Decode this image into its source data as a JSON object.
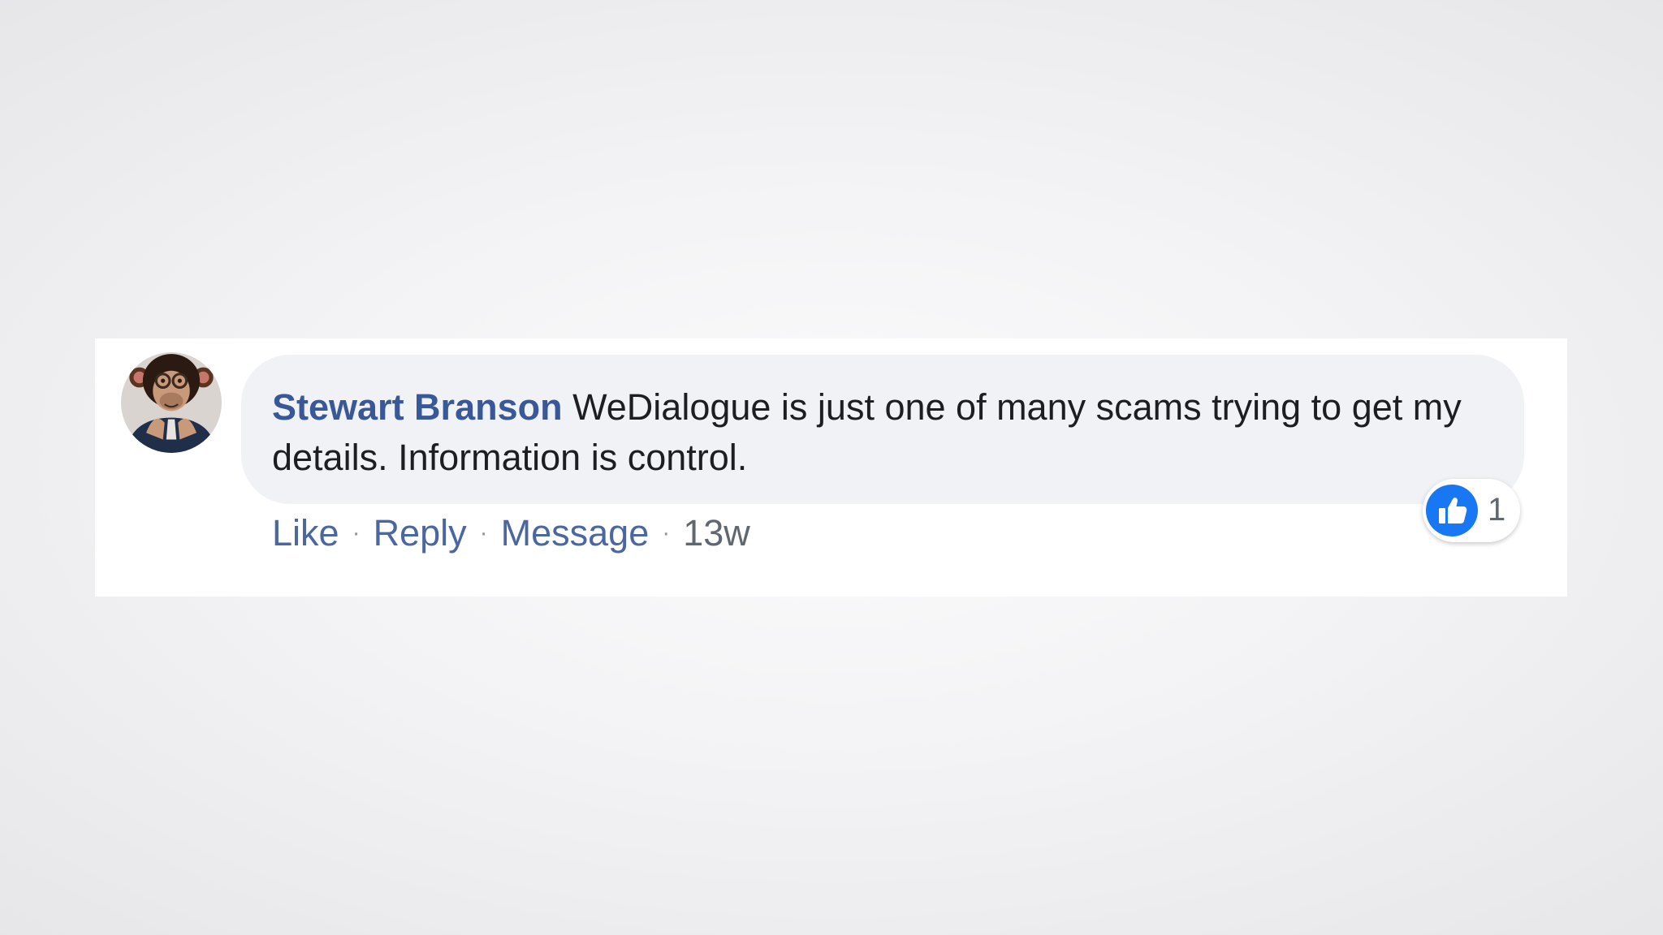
{
  "comment": {
    "author": "Stewart Branson",
    "text": "WeDialogue is just one of many scams trying to get my details. Information is control.",
    "avatar_icon": "chimpanzee-avatar"
  },
  "actions": {
    "like_label": "Like",
    "reply_label": "Reply",
    "message_label": "Message",
    "separator": "·",
    "timestamp": "13w"
  },
  "reactions": {
    "icon": "thumbs-up-icon",
    "count": "1",
    "color": "#1877f2"
  },
  "colors": {
    "author_link": "#385898",
    "action_link": "#4b67a1",
    "bubble_bg": "#f1f2f6"
  }
}
